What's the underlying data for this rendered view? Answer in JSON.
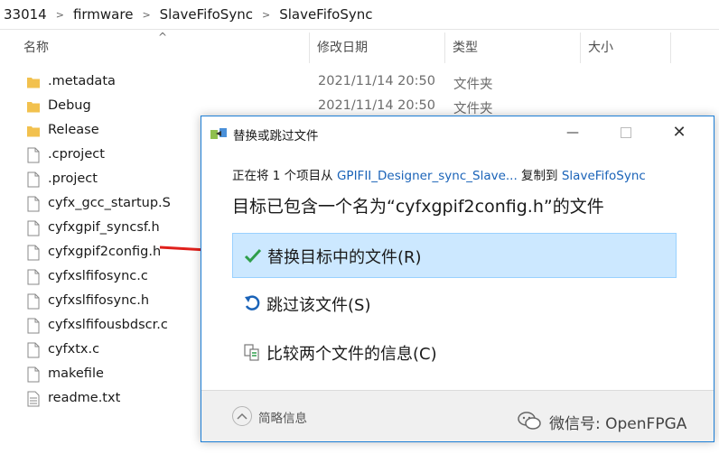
{
  "breadcrumb": [
    "33014",
    "firmware",
    "SlaveFifoSync",
    "SlaveFifoSync"
  ],
  "columns": {
    "name": "名称",
    "modified": "修改日期",
    "type": "类型",
    "size": "大小"
  },
  "files": [
    {
      "name": ".metadata",
      "date": "2021/11/14 20:50",
      "type": "文件夹",
      "kind": "folder"
    },
    {
      "name": "Debug",
      "date": "2021/11/14 20:50",
      "type": "文件夹",
      "kind": "folder"
    },
    {
      "name": "Release",
      "date": "",
      "type": "",
      "kind": "folder"
    },
    {
      "name": ".cproject",
      "date": "",
      "type": "",
      "kind": "file"
    },
    {
      "name": ".project",
      "date": "",
      "type": "",
      "kind": "file"
    },
    {
      "name": "cyfx_gcc_startup.S",
      "date": "",
      "type": "",
      "kind": "file"
    },
    {
      "name": "cyfxgpif_syncsf.h",
      "date": "",
      "type": "",
      "kind": "file"
    },
    {
      "name": "cyfxgpif2config.h",
      "date": "",
      "type": "",
      "kind": "file"
    },
    {
      "name": "cyfxslfifosync.c",
      "date": "",
      "type": "",
      "kind": "file"
    },
    {
      "name": "cyfxslfifosync.h",
      "date": "",
      "type": "",
      "kind": "file"
    },
    {
      "name": "cyfxslfifousbdscr.c",
      "date": "",
      "type": "",
      "kind": "file"
    },
    {
      "name": "cyfxtx.c",
      "date": "",
      "type": "",
      "kind": "file"
    },
    {
      "name": "makefile",
      "date": "",
      "type": "",
      "kind": "file"
    },
    {
      "name": "readme.txt",
      "date": "",
      "type": "",
      "kind": "text"
    }
  ],
  "dialog": {
    "title": "替换或跳过文件",
    "from_prefix": "正在将 1 个项目从 ",
    "from_source": "GPIFII_Designer_sync_Slave...",
    "from_middle": " 复制到 ",
    "from_dest": "SlaveFifoSync",
    "headline": "目标已包含一个名为“cyfxgpif2config.h”的文件",
    "options": [
      {
        "label": "替换目标中的文件(R)",
        "icon": "check-icon"
      },
      {
        "label": "跳过该文件(S)",
        "icon": "skip-icon"
      },
      {
        "label": "比较两个文件的信息(C)",
        "icon": "compare-icon"
      }
    ],
    "details_label": "简略信息"
  },
  "watermark": "微信号: OpenFPGA",
  "colors": {
    "accent": "#1a63b8",
    "selected_bg": "#cce8ff",
    "arrow": "#e0201b",
    "folder": "#f2c14e"
  }
}
